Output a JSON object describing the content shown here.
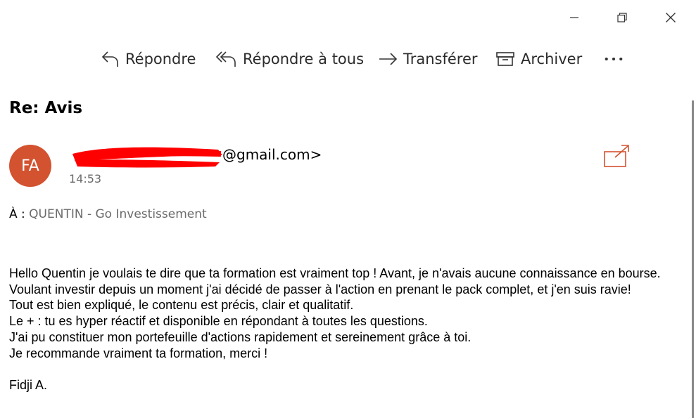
{
  "window": {
    "controls": [
      "minimize-icon",
      "restore-icon",
      "close-icon"
    ]
  },
  "toolbar": {
    "reply_label": "Répondre",
    "reply_all_label": "Répondre à tous",
    "forward_label": "Transférer",
    "archive_label": "Archiver",
    "more_label": "•••"
  },
  "message": {
    "subject": "Re: Avis",
    "avatar_initials": "FA",
    "avatar_color": "#d35230",
    "sender_visible": "@gmail.com>",
    "time": "14:53",
    "to_prefix": "À :",
    "to_recipient": "QUENTIN - Go Investissement",
    "body_lines": [
      "Hello Quentin je voulais te dire que ta formation est vraiment top ! Avant, je n'avais aucune connaissance en bourse. Voulant investir depuis un moment j'ai décidé de passer à l'action en prenant le pack complet, et j'en suis ravie!",
      "Tout est bien expliqué, le contenu est précis, clair et qualitatif.",
      "Le + : tu es hyper réactif et disponible en répondant à toutes les questions.",
      "J'ai pu constituer mon portefeuille d'actions rapidement et sereinement grâce à toi.",
      "Je recommande vraiment ta formation, merci !",
      "",
      "Fidji A."
    ]
  },
  "colors": {
    "accent": "#d35230",
    "redaction": "#ff0000"
  }
}
